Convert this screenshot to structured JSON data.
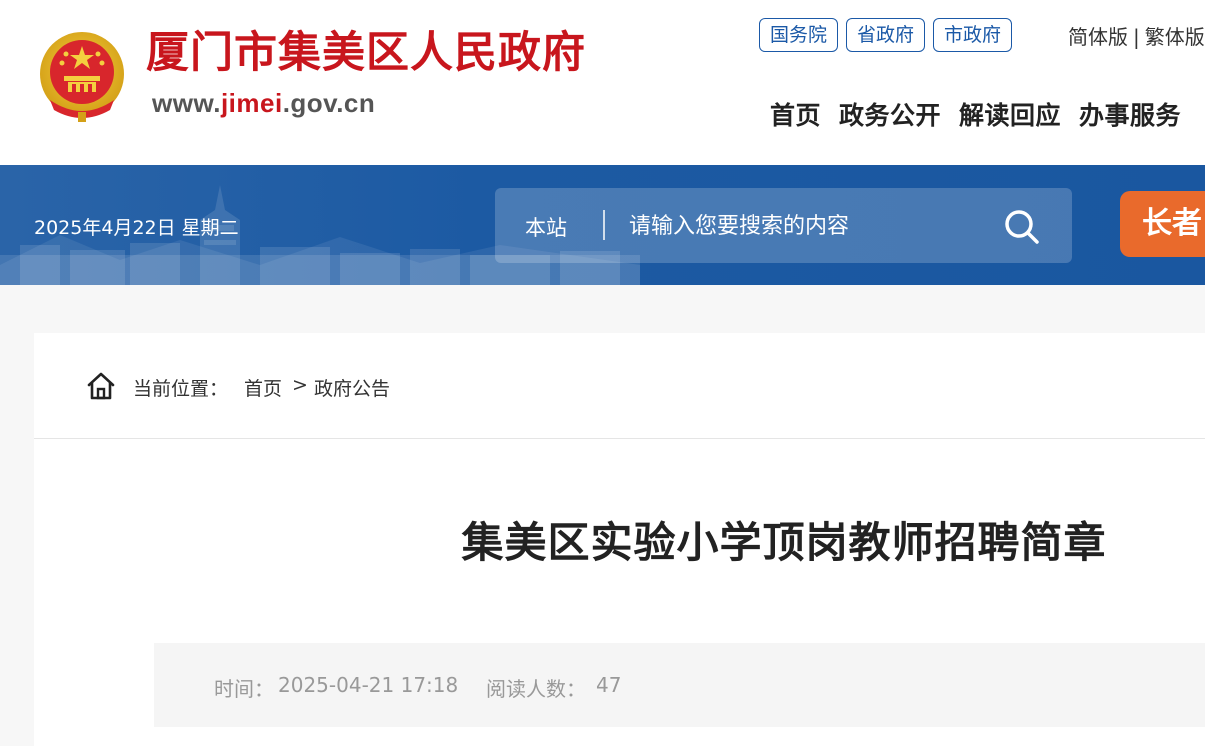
{
  "header": {
    "site_title": "厦门市集美区人民政府",
    "site_url_prefix": "www.",
    "site_url_accent": "jimei",
    "site_url_suffix": ".gov.cn",
    "gov_links": [
      "国务院",
      "省政府",
      "市政府"
    ],
    "lang": {
      "simplified": "简体版",
      "separator": "|",
      "traditional": "繁体版"
    },
    "nav": [
      "首页",
      "政务公开",
      "解读回应",
      "办事服务"
    ]
  },
  "banner": {
    "date": "2025年4月22日 星期二",
    "search_scope": "本站",
    "search_placeholder": "请输入您要搜索的内容",
    "elder_button": "长者"
  },
  "breadcrumb": {
    "label": "当前位置：",
    "items": [
      "首页",
      "政府公告"
    ],
    "separator": ">"
  },
  "article": {
    "title": "集美区实验小学顶岗教师招聘简章",
    "time_label": "时间：",
    "time_value": "2025-04-21 17:18",
    "reads_label": "阅读人数：",
    "reads_value": "47"
  },
  "colors": {
    "brand_red": "#c8161d",
    "nav_blue": "#1b59a7",
    "banner_blue": "#1c5aa3",
    "elder_orange": "#e96a2c"
  },
  "icons": [
    "national-emblem-icon",
    "search-icon",
    "home-icon"
  ]
}
